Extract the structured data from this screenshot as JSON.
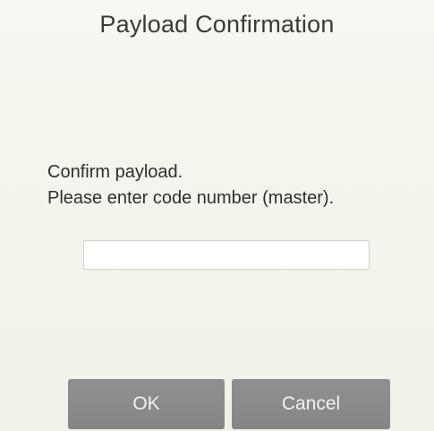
{
  "dialog": {
    "title": "Payload Confirmation",
    "message_line1": "Confirm payload.",
    "message_line2": "Please enter code number (master).",
    "code_input": {
      "value": "",
      "placeholder": ""
    },
    "ok_label": "OK",
    "cancel_label": "Cancel"
  },
  "colors": {
    "background": "#f6f6ef",
    "button_bg": "#8b8b8b",
    "button_text": "#f2f2f2",
    "input_bg": "#ffffff",
    "input_border": "#cfcfcf"
  }
}
